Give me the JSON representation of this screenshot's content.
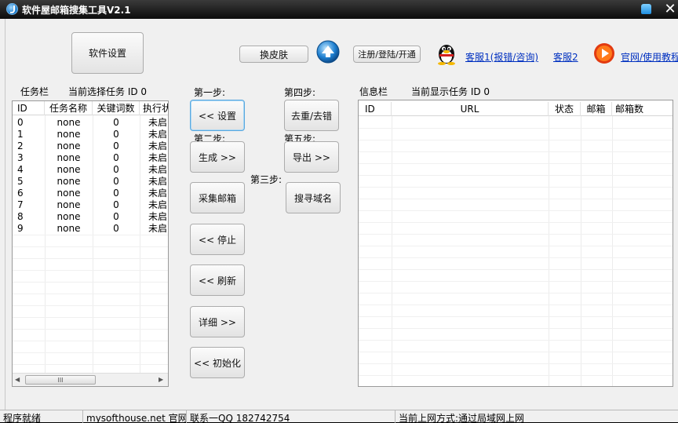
{
  "titlebar": {
    "title": "软件屋邮箱搜集工具V2.1"
  },
  "toolbar": {
    "settings_button": "软件设置",
    "skin_button": "换皮肤",
    "register_button": "注册/登陆/开通",
    "support1_link": "客服1(报错/咨询)",
    "support2_link": "客服2",
    "website_link": "官网/使用教程"
  },
  "task_panel": {
    "title": "任务栏",
    "current_task": "当前选择任务 ID 0",
    "columns": [
      "ID",
      "任务名称",
      "关键词数",
      "执行状"
    ],
    "rows": [
      {
        "id": "0",
        "name": "none",
        "keywords": "0",
        "status": "未启"
      },
      {
        "id": "1",
        "name": "none",
        "keywords": "0",
        "status": "未启"
      },
      {
        "id": "2",
        "name": "none",
        "keywords": "0",
        "status": "未启"
      },
      {
        "id": "3",
        "name": "none",
        "keywords": "0",
        "status": "未启"
      },
      {
        "id": "4",
        "name": "none",
        "keywords": "0",
        "status": "未启"
      },
      {
        "id": "5",
        "name": "none",
        "keywords": "0",
        "status": "未启"
      },
      {
        "id": "6",
        "name": "none",
        "keywords": "0",
        "status": "未启"
      },
      {
        "id": "7",
        "name": "none",
        "keywords": "0",
        "status": "未启"
      },
      {
        "id": "8",
        "name": "none",
        "keywords": "0",
        "status": "未启"
      },
      {
        "id": "9",
        "name": "none",
        "keywords": "0",
        "status": "未启"
      }
    ],
    "scroll_thumb": "III"
  },
  "steps": {
    "step1_label": "第一步:",
    "step2_label": "第二步:",
    "step3_label": "第三步:",
    "step4_label": "第四步:",
    "step5_label": "第五步:",
    "setup_button": "<< 设置",
    "generate_button": "生成 >>",
    "collect_button": "采集邮箱",
    "stop_button": "<< 停止",
    "refresh_button": "<< 刷新",
    "detail_button": "详细 >>",
    "init_button": "<< 初始化",
    "dedupe_button": "去重/去错",
    "export_button": "导出 >>",
    "search_domain_button": "搜寻域名"
  },
  "info_panel": {
    "title": "信息栏",
    "current_task": "当前显示任务 ID 0",
    "columns": [
      "ID",
      "URL",
      "状态",
      "邮箱",
      "邮箱数"
    ]
  },
  "statusbar": {
    "status": "程序就绪",
    "site": "mysofthouse.net 官网",
    "contact": "联系一QQ 182742754",
    "network": "当前上网方式:通过局域网上网"
  }
}
